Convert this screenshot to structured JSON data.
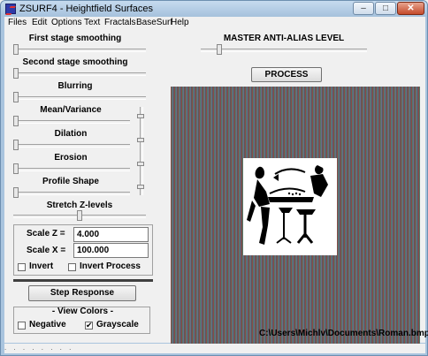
{
  "window": {
    "title": "ZSURF4 - Heightfield Surfaces"
  },
  "titlebar_buttons": {
    "minimize": "–",
    "maximize": "□",
    "close": "✕"
  },
  "menu": [
    "Files",
    "Edit",
    "Options",
    "Text",
    "Fractals",
    "BaseSurf",
    "Help"
  ],
  "sliders": {
    "first_stage_smoothing": {
      "label": "First stage smoothing",
      "value": 0.0
    },
    "second_stage_smoothing": {
      "label": "Second stage smoothing",
      "value": 0.0
    },
    "blurring": {
      "label": "Blurring",
      "value": 0.0
    },
    "mean_variance": {
      "label": "Mean/Variance",
      "value": 0.0
    },
    "dilation": {
      "label": "Dilation",
      "value": 0.0
    },
    "erosion": {
      "label": "Erosion",
      "value": 0.0
    },
    "profile_shape": {
      "label": "Profile Shape",
      "value": 0.0
    },
    "stretch_z_levels": {
      "label": "Stretch  Z-levels",
      "value": 0.5
    },
    "master_anti_alias": {
      "label": "MASTER ANTI-ALIAS LEVEL",
      "value": 0.1
    }
  },
  "scale": {
    "z_label": "Scale  Z  =",
    "z_value": "4.000",
    "x_label": "Scale  X  =",
    "x_value": "100.000"
  },
  "checkboxes": {
    "invert": {
      "label": "Invert",
      "checked": false
    },
    "invert_process": {
      "label": "Invert Process",
      "checked": false
    },
    "negative": {
      "label": "Negative",
      "checked": false
    },
    "grayscale": {
      "label": "Grayscale",
      "checked": true
    }
  },
  "buttons": {
    "process": "PROCESS",
    "step_response": "Step  Response"
  },
  "view_colors": {
    "label": "- View Colors -"
  },
  "file_path": "C:\\Users\\Michlv\\Documents\\Roman.bmp",
  "status": ". . . . . . . ."
}
